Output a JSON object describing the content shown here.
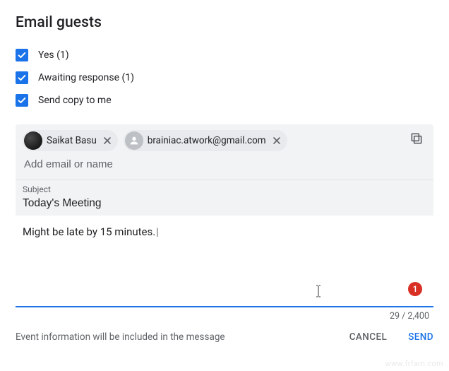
{
  "title": "Email guests",
  "checkboxes": {
    "yes": {
      "label": "Yes (1)",
      "checked": true
    },
    "awaiting": {
      "label": "Awaiting response (1)",
      "checked": true
    },
    "send_copy": {
      "label": "Send copy to me",
      "checked": true
    }
  },
  "recipients": [
    {
      "name": "Saikat Basu",
      "kind": "person"
    },
    {
      "name": "brainiac.atwork@gmail.com",
      "kind": "generic"
    }
  ],
  "add_email": {
    "placeholder": "Add email or name",
    "value": ""
  },
  "subject": {
    "label": "Subject",
    "value": "Today's Meeting"
  },
  "body": {
    "text": "Might be late by 15 minutes."
  },
  "counter": {
    "current": "29",
    "max": "2,400",
    "display": "29 / 2,400"
  },
  "badge": "1",
  "footer": {
    "note": "Event information will be included in the message",
    "cancel": "CANCEL",
    "send": "SEND"
  },
  "watermark": "www.frfam.com"
}
